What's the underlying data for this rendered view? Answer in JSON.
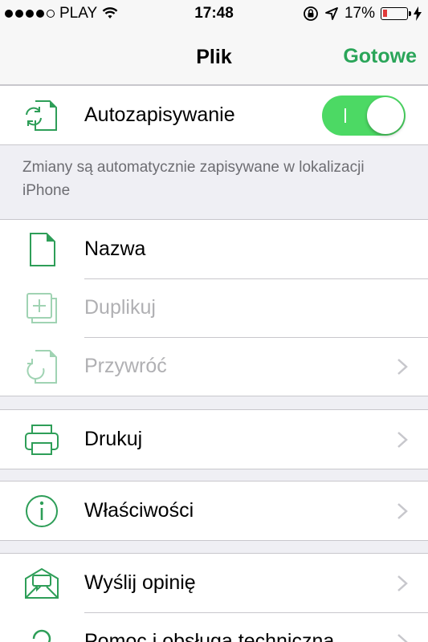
{
  "status_bar": {
    "carrier": "PLAY",
    "time": "17:48",
    "battery_percent": "17%",
    "battery_level": 0.17,
    "signal_bars": 4,
    "battery_color": "#e03a3a"
  },
  "nav": {
    "title": "Plik",
    "done_label": "Gotowe",
    "accent_color": "#2aa559"
  },
  "autosave": {
    "label": "Autozapisywanie",
    "enabled": true,
    "icon": "autosave-document-icon",
    "footnote": "Zmiany są automatycznie zapisywane w lokalizacji iPhone"
  },
  "file_group": [
    {
      "label": "Nazwa",
      "icon": "document-icon",
      "enabled": true,
      "chevron": false
    },
    {
      "label": "Duplikuj",
      "icon": "duplicate-icon",
      "enabled": false,
      "chevron": false
    },
    {
      "label": "Przywróć",
      "icon": "restore-icon",
      "enabled": false,
      "chevron": true
    }
  ],
  "print": {
    "label": "Drukuj",
    "icon": "printer-icon"
  },
  "properties": {
    "label": "Właściwości",
    "icon": "info-icon"
  },
  "help_group": [
    {
      "label": "Wyślij opinię",
      "icon": "feedback-envelope-icon"
    },
    {
      "label": "Pomoc i obsługa techniczna",
      "icon": "question-mark-icon"
    }
  ]
}
